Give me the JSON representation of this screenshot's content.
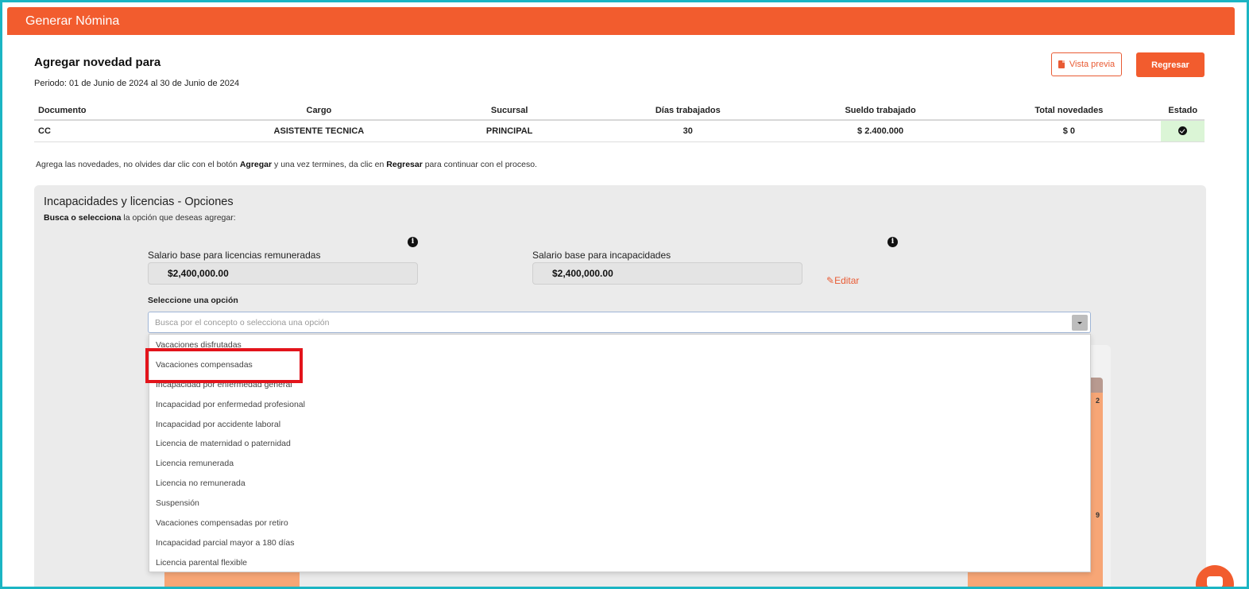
{
  "header": {
    "title": "Generar Nómina"
  },
  "page": {
    "title": "Agregar novedad para",
    "period": "Periodo: 01 de Junio de 2024 al 30 de Junio de 2024",
    "preview_button": "Vista previa",
    "back_button": "Regresar"
  },
  "table": {
    "headers": [
      "Documento",
      "Cargo",
      "Sucursal",
      "Días trabajados",
      "Sueldo trabajado",
      "Total novedades",
      "Estado"
    ],
    "row": {
      "documento": "CC",
      "cargo": "ASISTENTE TECNICA",
      "sucursal": "PRINCIPAL",
      "dias": "30",
      "sueldo": "$ 2.400.000",
      "total_novedades": "$ 0",
      "estado_icon": "check-circle-icon"
    }
  },
  "instructions": {
    "p1": "Agrega las novedades, no olvides dar clic con el botón ",
    "b1": "Agregar",
    "p2": " y una vez termines, da clic en ",
    "b2": "Regresar",
    "p3": " para continuar con el proceso."
  },
  "panel": {
    "title": "Incapacidades y licencias - Opciones",
    "subtitle_bold": "Busca o selecciona",
    "subtitle_rest": " la opción que deseas agregar:",
    "salary_licencias_label": "Salario base para licencias remuneradas",
    "salary_licencias_value": "$2,400,000.00",
    "salary_incapacidades_label": "Salario base para incapacidades",
    "salary_incapacidades_value": "$2,400,000.00",
    "edit_link": "Editar",
    "select_label": "Seleccione una opción",
    "select_placeholder": "Busca por el concepto o selecciona una opción",
    "options": [
      "Vacaciones disfrutadas",
      "Vacaciones compensadas",
      "Incapacidad por enfermedad general",
      "Incapacidad por enfermedad profesional",
      "Incapacidad por accidente laboral",
      "Licencia de maternidad o paternidad",
      "Licencia remunerada",
      "Licencia no remunerada",
      "Suspensión",
      "Vacaciones compensadas por retiro",
      "Incapacidad parcial mayor a 180 días",
      "Licencia parental flexible"
    ],
    "highlighted_option": "Vacaciones compensadas"
  },
  "background": {
    "num_a": "2",
    "num_b": "9"
  },
  "colors": {
    "brand": "#f25c2e",
    "frame": "#1bb5c3",
    "highlight": "#e3141b",
    "success_bg": "#dbf5d6"
  }
}
